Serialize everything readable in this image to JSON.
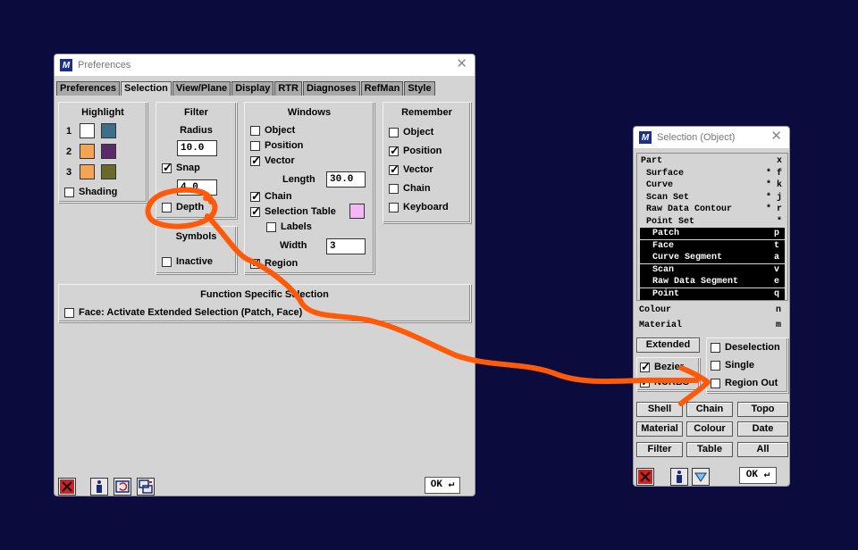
{
  "prefs": {
    "title": "Preferences",
    "tabs": [
      "Preferences",
      "Selection",
      "View/Plane",
      "Display",
      "RTR",
      "Diagnoses",
      "RefMan",
      "Style"
    ],
    "active_tab": "Selection",
    "highlight": {
      "title": "Highlight",
      "rows": [
        "1",
        "2",
        "3"
      ],
      "shading": "Shading"
    },
    "filter": {
      "title": "Filter",
      "radius_label": "Radius",
      "radius_value": "10.0",
      "snap": "Snap",
      "snap_value": "4.0",
      "depth": "Depth"
    },
    "symbols": {
      "title": "Symbols",
      "inactive": "Inactive"
    },
    "windows": {
      "title": "Windows",
      "object": "Object",
      "position": "Position",
      "vector": "Vector",
      "length_label": "Length",
      "length_value": "30.0",
      "chain": "Chain",
      "selection_table": "Selection Table",
      "labels": "Labels",
      "width_label": "Width",
      "width_value": "3",
      "region": "Region"
    },
    "remember": {
      "title": "Remember",
      "object": "Object",
      "position": "Position",
      "vector": "Vector",
      "chain": "Chain",
      "keyboard": "Keyboard"
    },
    "function": {
      "title": "Function Specific Selection",
      "face": "Face: Activate Extended Selection (Patch, Face)"
    },
    "ok": "OK ↵"
  },
  "sel": {
    "title": "Selection (Object)",
    "items": [
      {
        "label": "Part",
        "key": "x",
        "indent": 0,
        "sel": false
      },
      {
        "label": "Surface",
        "key": "* f",
        "indent": 1,
        "sel": false
      },
      {
        "label": "Curve",
        "key": "* k",
        "indent": 1,
        "sel": false
      },
      {
        "label": "Scan Set",
        "key": "* j",
        "indent": 1,
        "sel": false
      },
      {
        "label": "Raw Data Contour",
        "key": "* r",
        "indent": 1,
        "sel": false
      },
      {
        "label": "Point Set",
        "key": "*",
        "indent": 1,
        "sel": false
      },
      {
        "label": "Patch",
        "key": "p",
        "indent": 2,
        "sel": true
      },
      {
        "label": "Face",
        "key": "t",
        "indent": 2,
        "sel": true
      },
      {
        "label": "Curve Segment",
        "key": "a",
        "indent": 2,
        "sel": true
      },
      {
        "label": "Scan",
        "key": "v",
        "indent": 2,
        "sel": true
      },
      {
        "label": "Raw Data Segment",
        "key": "e",
        "indent": 2,
        "sel": true
      },
      {
        "label": "Point",
        "key": "q",
        "indent": 2,
        "sel": true
      }
    ],
    "colour": "Colour",
    "colour_key": "n",
    "material": "Material",
    "material_key": "m",
    "extended": "Extended",
    "bezier": "Bezier",
    "nurbs": "NURBS",
    "deselection": "Deselection",
    "single": "Single",
    "region_out": "Region Out",
    "grid": [
      "Shell",
      "Chain",
      "Topo",
      "Material",
      "Colour",
      "Date",
      "Filter",
      "Table",
      "All"
    ],
    "ok": "OK ↵"
  },
  "colors": {
    "background": "#0b0b3e",
    "annotation": "#ff5a0a",
    "swatch_orange": "#f4a455",
    "swatch_pink": "#f4b6f4"
  }
}
